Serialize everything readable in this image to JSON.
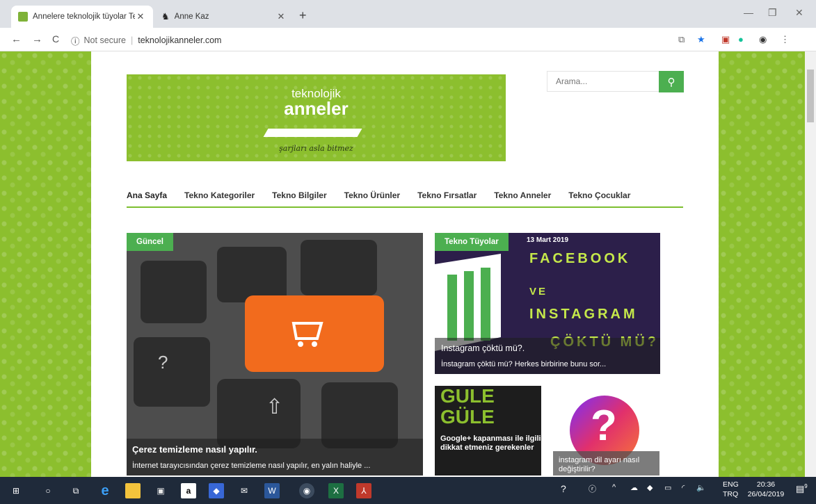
{
  "tabs": [
    {
      "title": "Annelere teknolojik tüyolar Tekno...",
      "close": "✕"
    },
    {
      "title": "Anne Kaz",
      "close": "✕"
    }
  ],
  "new_tab": "+",
  "window": {
    "minimize": "—",
    "restore": "❐",
    "close": "✕"
  },
  "address": {
    "security": "Not secure",
    "url": "teknolojikanneler.com"
  },
  "nav": {
    "back": "←",
    "forward": "→",
    "reload": "C",
    "info": "ⓘ"
  },
  "site": {
    "logo_line1": "teknolojik",
    "logo_line2": "anneler",
    "logo_tagline": "şarjları asla bitmez",
    "search_placeholder": "Arama...",
    "search_icon": "⚲"
  },
  "menu": [
    "Ana Sayfa",
    "Tekno Kategoriler",
    "Tekno Bilgiler",
    "Tekno Ürünler",
    "Tekno Fırsatlar",
    "Tekno Anneler",
    "Tekno Çocuklar"
  ],
  "cards": [
    {
      "tag": "Güncel",
      "title": "Çerez temizleme nasıl yapılır.",
      "summary": "İnternet tarayıcısından çerez temizleme nasıl yapılır, en yalın haliyle ..."
    },
    {
      "tag": "Tekno Tüyolar",
      "date": "13 Mart 2019",
      "poster": [
        "FACEBOOK",
        "VE",
        "INSTAGRAM",
        "ÇÖKTÜ MÜ?"
      ],
      "title": "Instagram çöktü mü?.",
      "summary": "İnstagram çöktü mü? Herkes birbirine bunu sor..."
    },
    {
      "poster": [
        "GULE",
        "GÜLE"
      ],
      "title": "Google+ kapanması ile ilgili dikkat etmeniz gerekenler"
    },
    {
      "title": "instagram dil ayarı nasıl değiştirilir?"
    }
  ],
  "tray": {
    "lang1": "ENG",
    "lang2": "TRQ",
    "time": "20:36",
    "date": "26/04/2019",
    "notif": "9"
  },
  "colors": {
    "accent": "#4caf50",
    "page_green": "#8cbf2e",
    "taskbar": "#1f2a3a"
  }
}
